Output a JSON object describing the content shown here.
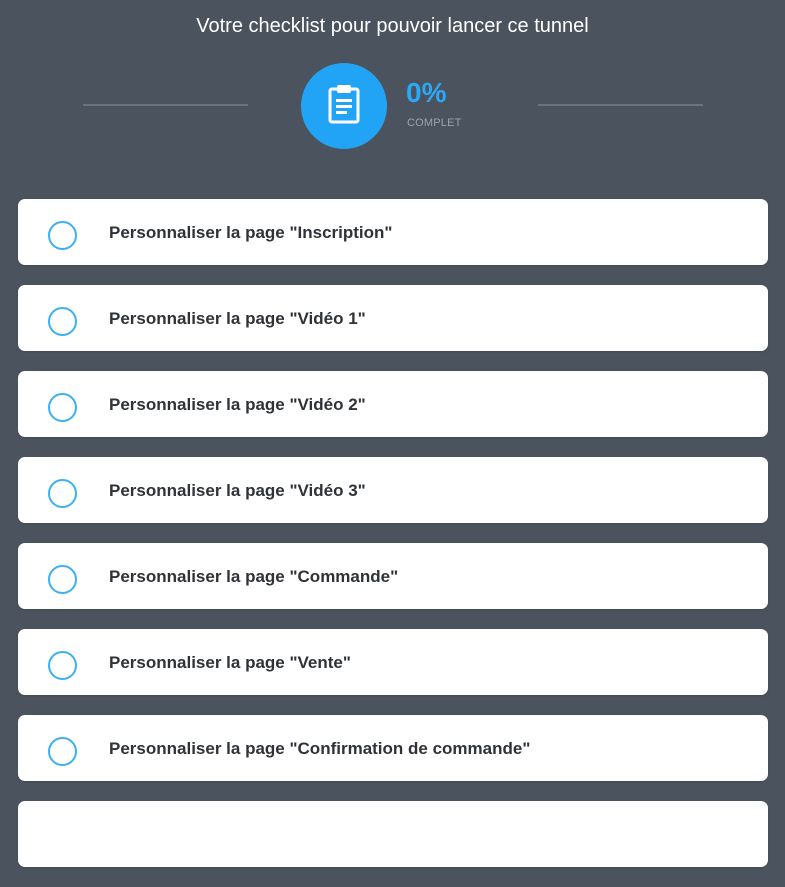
{
  "header": {
    "title": "Votre checklist pour pouvoir lancer ce tunnel",
    "progress_value": "0%",
    "progress_label": "COMPLET",
    "progress_fraction": 0,
    "icon": "clipboard-icon"
  },
  "checklist": {
    "items": [
      {
        "label": "Personnaliser la page \"Inscription\"",
        "checked": false
      },
      {
        "label": "Personnaliser la page \"Vidéo 1\"",
        "checked": false
      },
      {
        "label": "Personnaliser la page \"Vidéo 2\"",
        "checked": false
      },
      {
        "label": "Personnaliser la page \"Vidéo 3\"",
        "checked": false
      },
      {
        "label": "Personnaliser la page \"Commande\"",
        "checked": false
      },
      {
        "label": "Personnaliser la page \"Vente\"",
        "checked": false
      },
      {
        "label": "Personnaliser la page \"Confirmation de commande\"",
        "checked": false
      },
      {
        "label": "",
        "checked": false
      }
    ]
  },
  "colors": {
    "background": "#4b535e",
    "accent": "#22a4f6",
    "card": "#ffffff"
  }
}
